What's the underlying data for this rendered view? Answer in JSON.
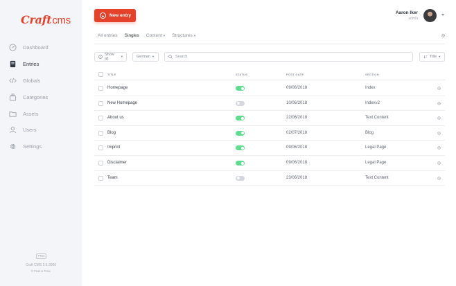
{
  "logo": {
    "part1": "Craft",
    "part2": "cms"
  },
  "sidebar": {
    "items": [
      {
        "label": "Dashboard",
        "icon": "gauge-icon",
        "active": false
      },
      {
        "label": "Entries",
        "icon": "book-icon",
        "active": true
      },
      {
        "label": "Globals",
        "icon": "code-icon",
        "active": false
      },
      {
        "label": "Categories",
        "icon": "stack-icon",
        "active": false
      },
      {
        "label": "Assets",
        "icon": "folder-icon",
        "active": false
      },
      {
        "label": "Users",
        "icon": "user-icon",
        "active": false
      },
      {
        "label": "Settings",
        "icon": "gear-icon",
        "active": false
      }
    ],
    "footer": {
      "badge": "PRO",
      "version": "Craft CMS 2.6.3000",
      "credit": "© Pixel & Tonic"
    }
  },
  "header": {
    "new_entry_label": "New entry",
    "user_name": "Aaron Iker",
    "user_role": "admin"
  },
  "tabs": [
    {
      "label": "All entries",
      "dropdown": false,
      "active": false
    },
    {
      "label": "Singles",
      "dropdown": false,
      "active": true
    },
    {
      "label": "Content",
      "dropdown": true,
      "active": false
    },
    {
      "label": "Structures",
      "dropdown": true,
      "active": false
    }
  ],
  "toolbar": {
    "show_all": "Show all",
    "language": "German",
    "search_placeholder": "Search",
    "sort": "Title"
  },
  "table": {
    "columns": [
      "TITLE",
      "STATUS",
      "POST DATE",
      "SECTION"
    ],
    "rows": [
      {
        "title": "Homepage",
        "status": true,
        "date": "09/06/2018",
        "section": "Index"
      },
      {
        "title": "New Homepage",
        "status": false,
        "date": "10/06/2018",
        "section": "Indexv2"
      },
      {
        "title": "About us",
        "status": true,
        "date": "22/06/2018",
        "section": "Text Content"
      },
      {
        "title": "Blog",
        "status": true,
        "date": "02/07/2018",
        "section": "Blog"
      },
      {
        "title": "Imprint",
        "status": true,
        "date": "09/06/2018",
        "section": "Legal Page"
      },
      {
        "title": "Disclaimer",
        "status": true,
        "date": "09/06/2018",
        "section": "Legal Page"
      },
      {
        "title": "Team",
        "status": false,
        "date": "23/06/2018",
        "section": "Text Content"
      }
    ]
  },
  "colors": {
    "accent": "#e5422b",
    "toggle_on": "#5fdc8f",
    "toggle_off": "#d4d8de",
    "sidebar_bg": "#f4f5f8"
  }
}
